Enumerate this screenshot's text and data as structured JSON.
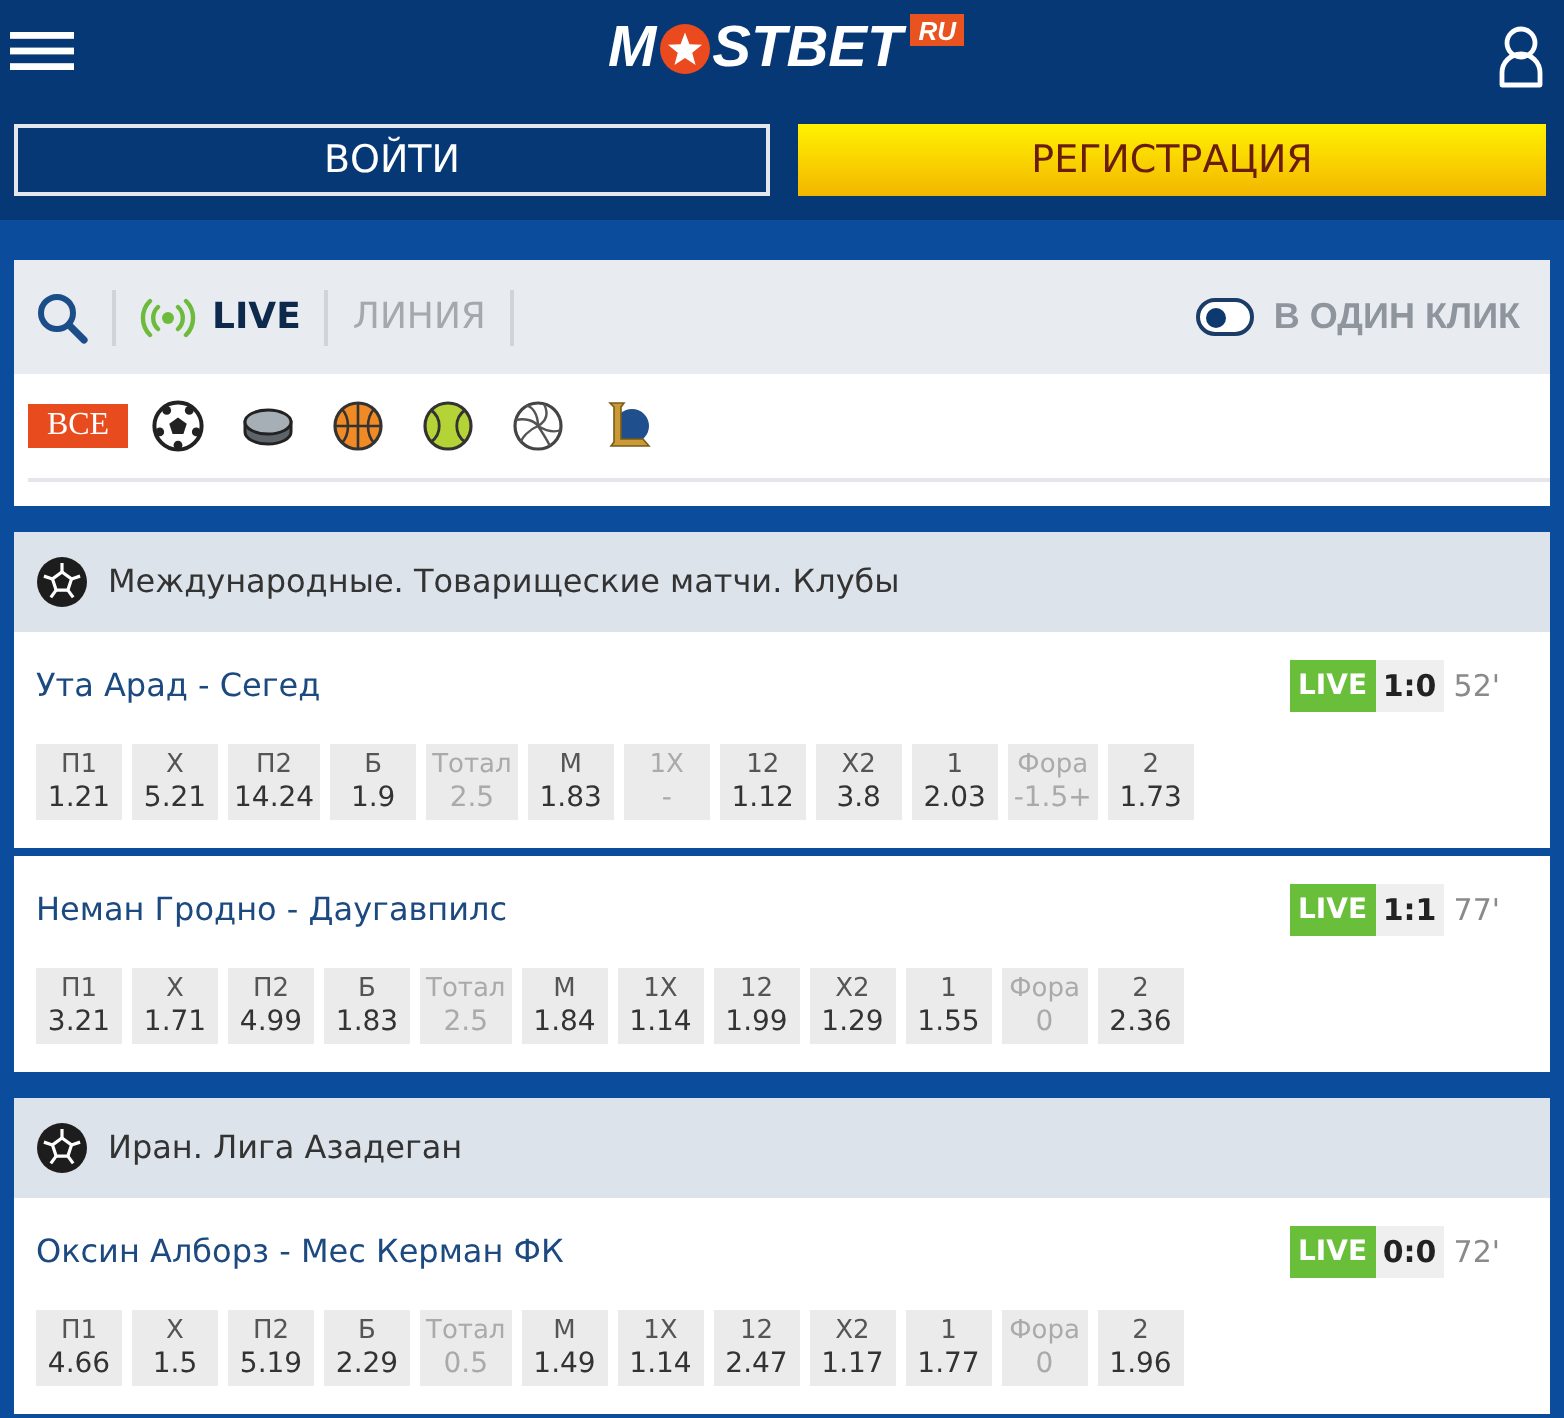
{
  "header": {
    "logo_start": "M",
    "logo_end": "STBET",
    "logo_badge": "RU"
  },
  "auth_buttons": [
    {
      "kind": "outline",
      "label": "ВОЙТИ"
    },
    {
      "kind": "accent",
      "label": "РЕГИСТРАЦИЯ"
    }
  ],
  "mode_tabs": [
    {
      "kind": "live",
      "label": "LIVE",
      "selected": true
    },
    {
      "kind": "line",
      "label": "ЛИНИЯ",
      "selected": false
    }
  ],
  "one_click": {
    "label": "В ОДИН КЛИК",
    "on": false
  },
  "sport_filters": [
    {
      "kind": "all",
      "label": "ВСЕ",
      "selected": true
    },
    {
      "kind": "soccer",
      "selected": false
    },
    {
      "kind": "hockey",
      "selected": false
    },
    {
      "kind": "basketball",
      "selected": false
    },
    {
      "kind": "tennis",
      "selected": false
    },
    {
      "kind": "volleyball",
      "selected": false
    },
    {
      "kind": "esports",
      "selected": false
    }
  ],
  "leagues": [
    {
      "kind": "soccer",
      "name": "Международные. Товарищеские матчи. Клубы",
      "matches": [
        {
          "teams": "Ута Арад - Сегед",
          "status": "LIVE",
          "score": "1:0",
          "minute": "52'",
          "odds": [
            {
              "label": "П1",
              "value": "1.21",
              "disabled": false
            },
            {
              "label": "Х",
              "value": "5.21",
              "disabled": false
            },
            {
              "label": "П2",
              "value": "14.24",
              "disabled": false
            },
            {
              "label": "Б",
              "value": "1.9",
              "disabled": false
            },
            {
              "label": "Тотал",
              "value": "2.5",
              "disabled": true
            },
            {
              "label": "М",
              "value": "1.83",
              "disabled": false
            },
            {
              "label": "1Х",
              "value": "-",
              "disabled": true
            },
            {
              "label": "12",
              "value": "1.12",
              "disabled": false
            },
            {
              "label": "Х2",
              "value": "3.8",
              "disabled": false
            },
            {
              "label": "1",
              "value": "2.03",
              "disabled": false
            },
            {
              "label": "Фора",
              "value": "-1.5+",
              "disabled": true
            },
            {
              "label": "2",
              "value": "1.73",
              "disabled": false
            }
          ]
        },
        {
          "teams": "Неман Гродно - Даугавпилс",
          "status": "LIVE",
          "score": "1:1",
          "minute": "77'",
          "odds": [
            {
              "label": "П1",
              "value": "3.21",
              "disabled": false
            },
            {
              "label": "Х",
              "value": "1.71",
              "disabled": false
            },
            {
              "label": "П2",
              "value": "4.99",
              "disabled": false
            },
            {
              "label": "Б",
              "value": "1.83",
              "disabled": false
            },
            {
              "label": "Тотал",
              "value": "2.5",
              "disabled": true
            },
            {
              "label": "М",
              "value": "1.84",
              "disabled": false
            },
            {
              "label": "1Х",
              "value": "1.14",
              "disabled": false
            },
            {
              "label": "12",
              "value": "1.99",
              "disabled": false
            },
            {
              "label": "Х2",
              "value": "1.29",
              "disabled": false
            },
            {
              "label": "1",
              "value": "1.55",
              "disabled": false
            },
            {
              "label": "Фора",
              "value": "0",
              "disabled": true
            },
            {
              "label": "2",
              "value": "2.36",
              "disabled": false
            }
          ]
        }
      ]
    },
    {
      "kind": "soccer",
      "name": "Иран. Лига Азадеган",
      "matches": [
        {
          "teams": "Оксин Алборз - Мес Керман ФК",
          "status": "LIVE",
          "score": "0:0",
          "minute": "72'",
          "odds": [
            {
              "label": "П1",
              "value": "4.66",
              "disabled": false
            },
            {
              "label": "Х",
              "value": "1.5",
              "disabled": false
            },
            {
              "label": "П2",
              "value": "5.19",
              "disabled": false
            },
            {
              "label": "Б",
              "value": "2.29",
              "disabled": false
            },
            {
              "label": "Тотал",
              "value": "0.5",
              "disabled": true
            },
            {
              "label": "М",
              "value": "1.49",
              "disabled": false
            },
            {
              "label": "1Х",
              "value": "1.14",
              "disabled": false
            },
            {
              "label": "12",
              "value": "2.47",
              "disabled": false
            },
            {
              "label": "Х2",
              "value": "1.17",
              "disabled": false
            },
            {
              "label": "1",
              "value": "1.77",
              "disabled": false
            },
            {
              "label": "Фора",
              "value": "0",
              "disabled": true
            },
            {
              "label": "2",
              "value": "1.96",
              "disabled": false
            }
          ]
        }
      ]
    }
  ]
}
